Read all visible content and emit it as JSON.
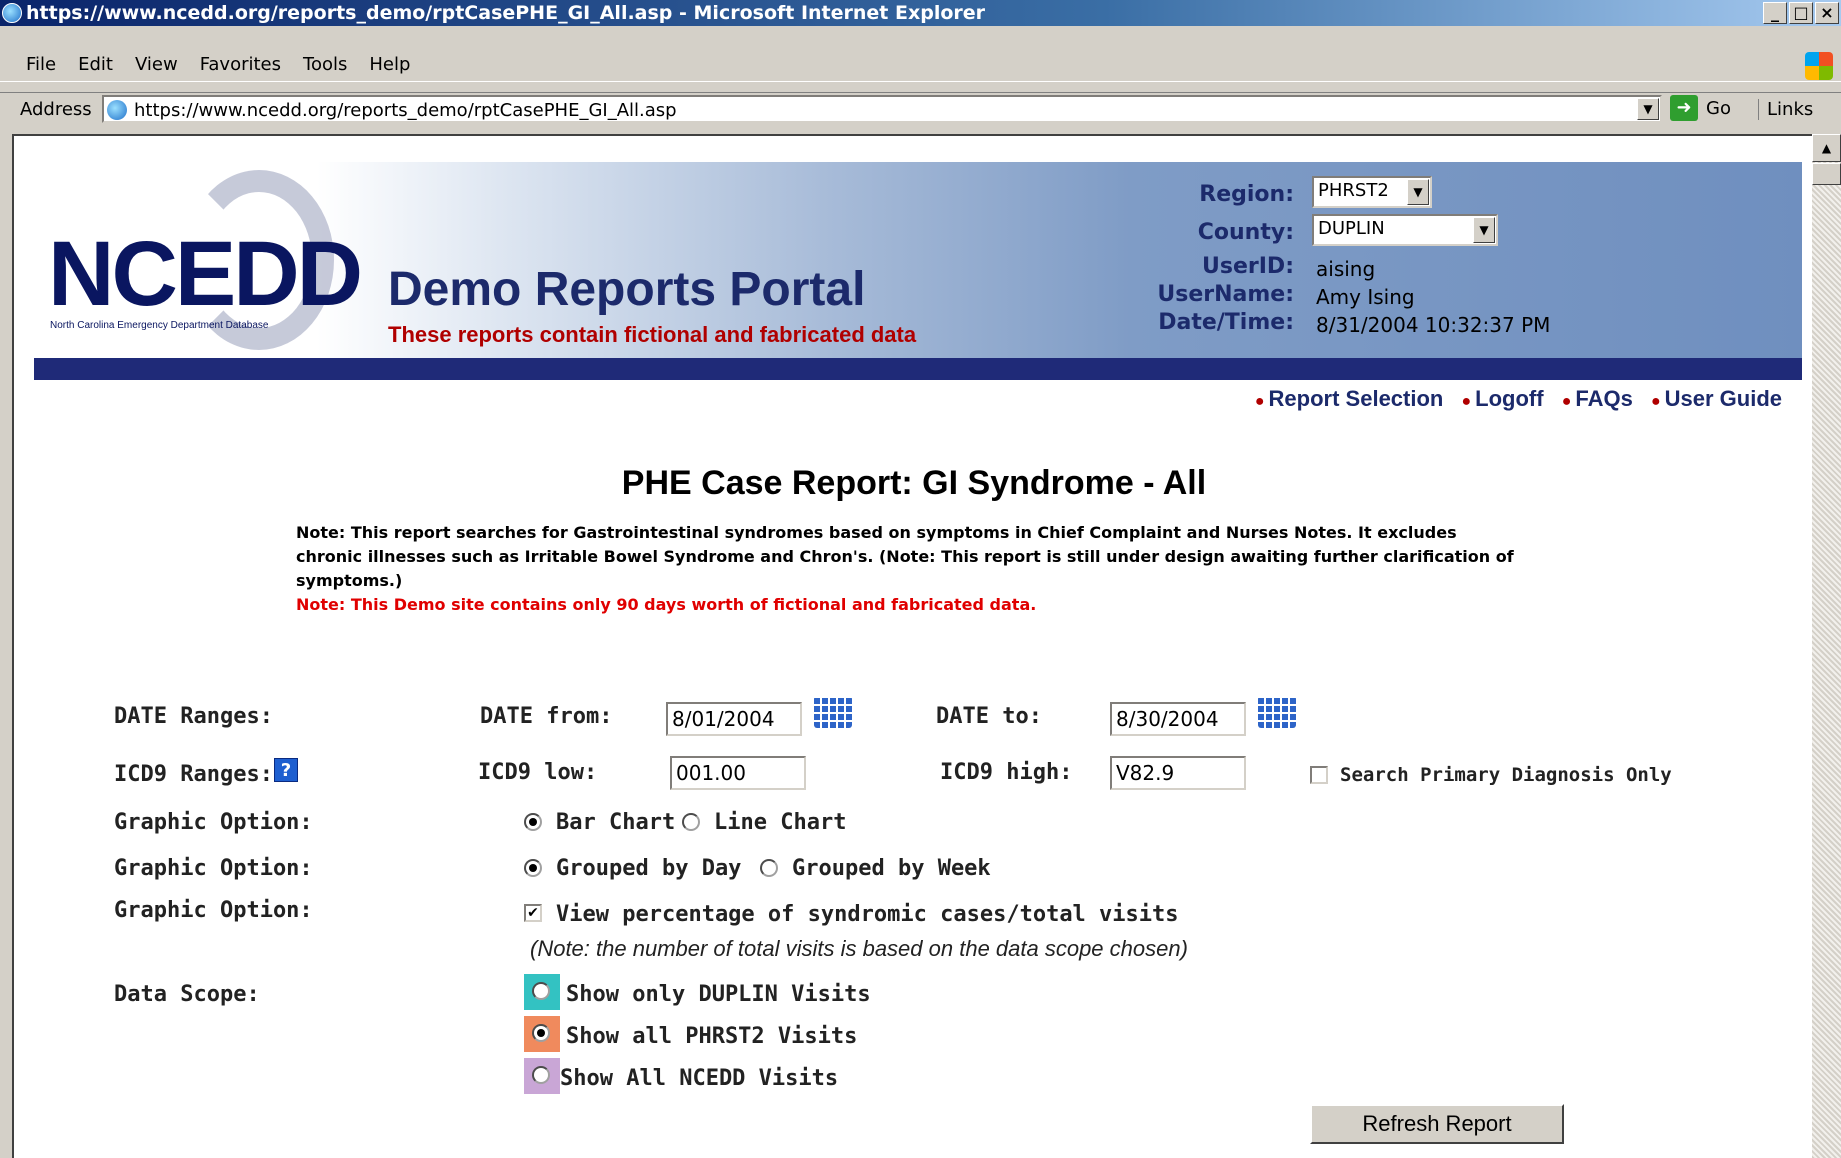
{
  "window": {
    "title": "https://www.ncedd.org/reports_demo/rptCasePHE_GI_All.asp - Microsoft Internet Explorer",
    "controls": [
      "_",
      "□",
      "×"
    ]
  },
  "menu": [
    "File",
    "Edit",
    "View",
    "Favorites",
    "Tools",
    "Help"
  ],
  "address": {
    "label": "Address",
    "url": "https://www.ncedd.org/reports_demo/rptCasePHE_GI_All.asp",
    "go": "Go",
    "links": "Links"
  },
  "header": {
    "logo": "NCEDD",
    "logo_sub": "North Carolina Emergency Department Database",
    "portal_title": "Demo Reports Portal",
    "portal_sub": "These reports contain fictional and fabricated data",
    "region_label": "Region:",
    "region_value": "PHRST2",
    "county_label": "County:",
    "county_value": "DUPLIN",
    "userid_label": "UserID:",
    "userid_value": "aising",
    "username_label": "UserName:",
    "username_value": "Amy Ising",
    "datetime_label": "Date/Time:",
    "datetime_value": "8/31/2004 10:32:37 PM"
  },
  "nav": [
    "Report Selection",
    "Logoff",
    "FAQs",
    "User Guide"
  ],
  "report": {
    "title": "PHE Case Report: GI Syndrome - All",
    "note": "Note: This report searches for Gastrointestinal syndromes based on symptoms in Chief Complaint and Nurses Notes. It excludes chronic illnesses such as Irritable Bowel Syndrome and Chron's. (Note: This report is still under design awaiting further clarification of symptoms.)",
    "note_red": "Note: This Demo site contains only 90 days worth of fictional and fabricated data."
  },
  "form": {
    "date_ranges_label": "DATE Ranges:",
    "date_from_label": "DATE from:",
    "date_from_value": "8/01/2004",
    "date_to_label": "DATE to:",
    "date_to_value": "8/30/2004",
    "icd9_ranges_label": "ICD9 Ranges:",
    "icd9_low_label": "ICD9 low:",
    "icd9_low_value": "001.00",
    "icd9_high_label": "ICD9 high:",
    "icd9_high_value": "V82.9",
    "primary_dx_label": "Search Primary Diagnosis Only",
    "graphic_option_label": "Graphic Option:",
    "bar_chart": "Bar Chart",
    "line_chart": "Line Chart",
    "grouped_day": "Grouped by Day",
    "grouped_week": "Grouped by Week",
    "view_pct": "View percentage of syndromic cases/total visits",
    "view_pct_note": "(Note: the number of total visits is based on the data scope chosen)",
    "data_scope_label": "Data Scope:",
    "scope_county": "Show only DUPLIN Visits",
    "scope_region": "Show all PHRST2 Visits",
    "scope_all": "Show All NCEDD Visits",
    "refresh": "Refresh Report"
  },
  "colors": {
    "scope_county": "#33c2c2",
    "scope_region": "#f08a5d",
    "scope_all": "#c9a6d6"
  }
}
